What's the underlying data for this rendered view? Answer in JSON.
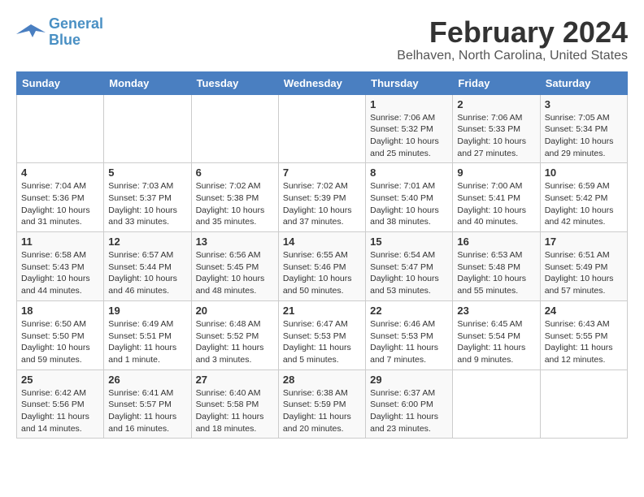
{
  "logo": {
    "line1": "General",
    "line2": "Blue"
  },
  "title": "February 2024",
  "location": "Belhaven, North Carolina, United States",
  "headers": [
    "Sunday",
    "Monday",
    "Tuesday",
    "Wednesday",
    "Thursday",
    "Friday",
    "Saturday"
  ],
  "weeks": [
    [
      {
        "day": "",
        "info": ""
      },
      {
        "day": "",
        "info": ""
      },
      {
        "day": "",
        "info": ""
      },
      {
        "day": "",
        "info": ""
      },
      {
        "day": "1",
        "info": "Sunrise: 7:06 AM\nSunset: 5:32 PM\nDaylight: 10 hours\nand 25 minutes."
      },
      {
        "day": "2",
        "info": "Sunrise: 7:06 AM\nSunset: 5:33 PM\nDaylight: 10 hours\nand 27 minutes."
      },
      {
        "day": "3",
        "info": "Sunrise: 7:05 AM\nSunset: 5:34 PM\nDaylight: 10 hours\nand 29 minutes."
      }
    ],
    [
      {
        "day": "4",
        "info": "Sunrise: 7:04 AM\nSunset: 5:36 PM\nDaylight: 10 hours\nand 31 minutes."
      },
      {
        "day": "5",
        "info": "Sunrise: 7:03 AM\nSunset: 5:37 PM\nDaylight: 10 hours\nand 33 minutes."
      },
      {
        "day": "6",
        "info": "Sunrise: 7:02 AM\nSunset: 5:38 PM\nDaylight: 10 hours\nand 35 minutes."
      },
      {
        "day": "7",
        "info": "Sunrise: 7:02 AM\nSunset: 5:39 PM\nDaylight: 10 hours\nand 37 minutes."
      },
      {
        "day": "8",
        "info": "Sunrise: 7:01 AM\nSunset: 5:40 PM\nDaylight: 10 hours\nand 38 minutes."
      },
      {
        "day": "9",
        "info": "Sunrise: 7:00 AM\nSunset: 5:41 PM\nDaylight: 10 hours\nand 40 minutes."
      },
      {
        "day": "10",
        "info": "Sunrise: 6:59 AM\nSunset: 5:42 PM\nDaylight: 10 hours\nand 42 minutes."
      }
    ],
    [
      {
        "day": "11",
        "info": "Sunrise: 6:58 AM\nSunset: 5:43 PM\nDaylight: 10 hours\nand 44 minutes."
      },
      {
        "day": "12",
        "info": "Sunrise: 6:57 AM\nSunset: 5:44 PM\nDaylight: 10 hours\nand 46 minutes."
      },
      {
        "day": "13",
        "info": "Sunrise: 6:56 AM\nSunset: 5:45 PM\nDaylight: 10 hours\nand 48 minutes."
      },
      {
        "day": "14",
        "info": "Sunrise: 6:55 AM\nSunset: 5:46 PM\nDaylight: 10 hours\nand 50 minutes."
      },
      {
        "day": "15",
        "info": "Sunrise: 6:54 AM\nSunset: 5:47 PM\nDaylight: 10 hours\nand 53 minutes."
      },
      {
        "day": "16",
        "info": "Sunrise: 6:53 AM\nSunset: 5:48 PM\nDaylight: 10 hours\nand 55 minutes."
      },
      {
        "day": "17",
        "info": "Sunrise: 6:51 AM\nSunset: 5:49 PM\nDaylight: 10 hours\nand 57 minutes."
      }
    ],
    [
      {
        "day": "18",
        "info": "Sunrise: 6:50 AM\nSunset: 5:50 PM\nDaylight: 10 hours\nand 59 minutes."
      },
      {
        "day": "19",
        "info": "Sunrise: 6:49 AM\nSunset: 5:51 PM\nDaylight: 11 hours\nand 1 minute."
      },
      {
        "day": "20",
        "info": "Sunrise: 6:48 AM\nSunset: 5:52 PM\nDaylight: 11 hours\nand 3 minutes."
      },
      {
        "day": "21",
        "info": "Sunrise: 6:47 AM\nSunset: 5:53 PM\nDaylight: 11 hours\nand 5 minutes."
      },
      {
        "day": "22",
        "info": "Sunrise: 6:46 AM\nSunset: 5:53 PM\nDaylight: 11 hours\nand 7 minutes."
      },
      {
        "day": "23",
        "info": "Sunrise: 6:45 AM\nSunset: 5:54 PM\nDaylight: 11 hours\nand 9 minutes."
      },
      {
        "day": "24",
        "info": "Sunrise: 6:43 AM\nSunset: 5:55 PM\nDaylight: 11 hours\nand 12 minutes."
      }
    ],
    [
      {
        "day": "25",
        "info": "Sunrise: 6:42 AM\nSunset: 5:56 PM\nDaylight: 11 hours\nand 14 minutes."
      },
      {
        "day": "26",
        "info": "Sunrise: 6:41 AM\nSunset: 5:57 PM\nDaylight: 11 hours\nand 16 minutes."
      },
      {
        "day": "27",
        "info": "Sunrise: 6:40 AM\nSunset: 5:58 PM\nDaylight: 11 hours\nand 18 minutes."
      },
      {
        "day": "28",
        "info": "Sunrise: 6:38 AM\nSunset: 5:59 PM\nDaylight: 11 hours\nand 20 minutes."
      },
      {
        "day": "29",
        "info": "Sunrise: 6:37 AM\nSunset: 6:00 PM\nDaylight: 11 hours\nand 23 minutes."
      },
      {
        "day": "",
        "info": ""
      },
      {
        "day": "",
        "info": ""
      }
    ]
  ]
}
